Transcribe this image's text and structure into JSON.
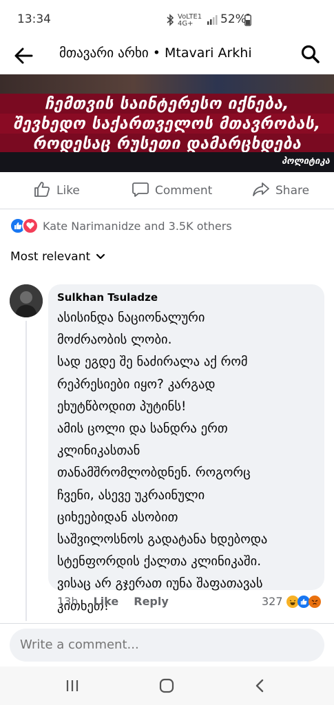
{
  "status_bar": {
    "time": "13:34",
    "network": "VoLTE1 4G+",
    "battery": "52%"
  },
  "header": {
    "title": "მთავარი არხი • Mtavari Arkhi"
  },
  "banner": {
    "line1": "ჩემთვის საინტერესო იქნება,",
    "line2": "შევხედო საქართველოს მთავრობას,",
    "line3": "როდესაც რუსეთი დამარცხდება",
    "brand": "პოლიტიკა"
  },
  "actions": {
    "like": "Like",
    "comment": "Comment",
    "share": "Share"
  },
  "reactions": {
    "summary": "Kate Narimanidze and 3.5K others"
  },
  "sort": {
    "label": "Most relevant"
  },
  "comment": {
    "author": "Sulkhan Tsuladze",
    "text": "ასისინდა ნაციონალური\nმოძრაობის ლობი.\nსად ეგდე შე ნაძირალა აქ რომ\nრეპრესიები იყო? კარგად\nეხუტწბოდით პუტინს!\nამის ცოლი და სანდრა ერთ\nკლინიკასთან\nთანამშრომლობდნენ. როგორც\nჩვენი, ასევე უკრაინული\nციხეებიდან ასობით\nსაშვილოსნოს გადატანა ხდებოდა\nსტენფორდის ქალთა კლინიკაში.\nვისაც არ გჯერათ იუნა შაფათავას\nკითხეთ!",
    "time_ago": "13h",
    "like": "Like",
    "reply": "Reply",
    "reaction_count": "327"
  },
  "compose": {
    "placeholder": "Write a comment..."
  },
  "colors": {
    "fb_blue": "#1877f2",
    "love_red": "#f33e58",
    "banner_red": "#8e0c25"
  }
}
